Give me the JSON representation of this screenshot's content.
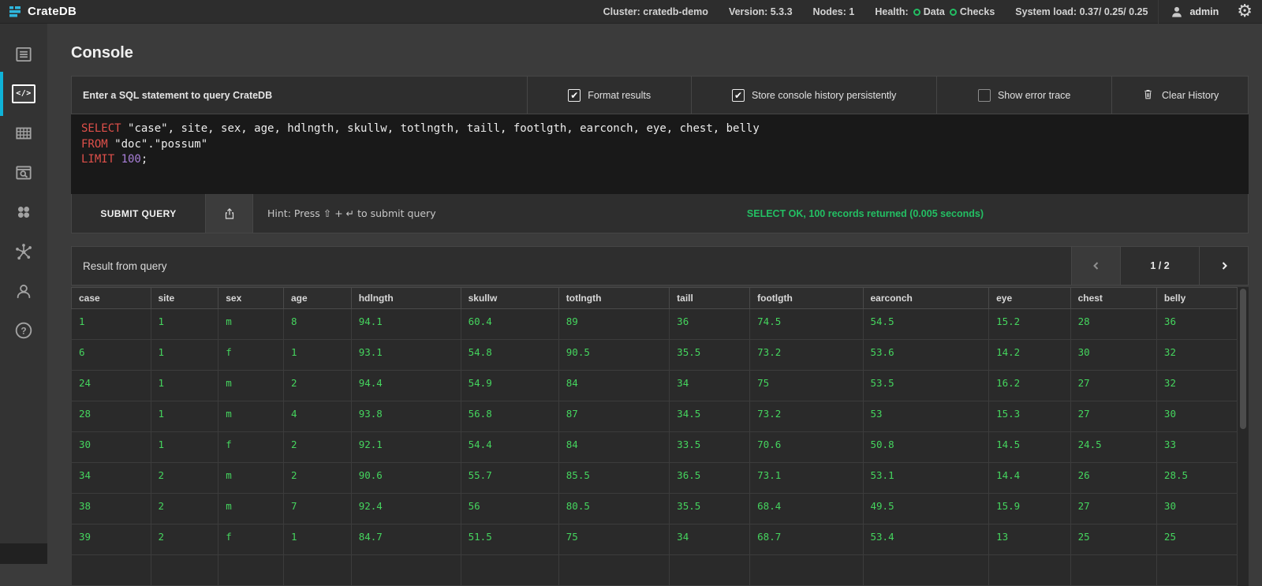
{
  "topbar": {
    "brand": "CrateDB",
    "cluster": "Cluster: cratedb-demo",
    "version": "Version: 5.3.3",
    "nodes": "Nodes: 1",
    "health_label": "Health:",
    "health_items": [
      "Data",
      "Checks"
    ],
    "load": "System load: 0.37/ 0.25/ 0.25",
    "user": "admin"
  },
  "sidebar": {
    "items": [
      "overview",
      "console",
      "tables",
      "shards",
      "privileges",
      "cluster",
      "account",
      "help"
    ],
    "active_item": "console",
    "accent_color": "#0fb3d8"
  },
  "console": {
    "title": "Console",
    "editor_label": "Enter a SQL statement to query CrateDB",
    "options": [
      {
        "label": "Format results",
        "checked": true
      },
      {
        "label": "Store console history persistently",
        "checked": true
      },
      {
        "label": "Show error trace",
        "checked": false
      }
    ],
    "clear_history_label": "Clear History",
    "sql_lines": [
      [
        {
          "t": "kw",
          "v": "SELECT "
        },
        {
          "t": "p",
          "v": "\"case\", site, sex, age, hdlngth, skullw, totlngth, taill, footlgth, earconch, eye, chest, belly"
        }
      ],
      [
        {
          "t": "kw",
          "v": "FROM "
        },
        {
          "t": "p",
          "v": "\"doc\".\"possum\""
        }
      ],
      [
        {
          "t": "kw",
          "v": "LIMIT "
        },
        {
          "t": "num",
          "v": "100"
        },
        {
          "t": "p",
          "v": ";"
        }
      ]
    ],
    "submit_label": "SUBMIT QUERY",
    "hint": "Hint: Press ⇧ + ↵ to submit query",
    "status": "SELECT OK, 100 records returned (0.005 seconds)"
  },
  "results": {
    "title": "Result from query",
    "page_indicator": "1 / 2",
    "columns": [
      "case",
      "site",
      "sex",
      "age",
      "hdlngth",
      "skullw",
      "totlngth",
      "taill",
      "footlgth",
      "earconch",
      "eye",
      "chest",
      "belly"
    ],
    "col_widths_pct": [
      6.8,
      5.8,
      5.6,
      5.8,
      9.4,
      8.4,
      9.5,
      6.9,
      9.7,
      10.8,
      7.0,
      7.4,
      6.9
    ],
    "rows": [
      [
        "1",
        "1",
        "m",
        "8",
        "94.1",
        "60.4",
        "89",
        "36",
        "74.5",
        "54.5",
        "15.2",
        "28",
        "36"
      ],
      [
        "6",
        "1",
        "f",
        "1",
        "93.1",
        "54.8",
        "90.5",
        "35.5",
        "73.2",
        "53.6",
        "14.2",
        "30",
        "32"
      ],
      [
        "24",
        "1",
        "m",
        "2",
        "94.4",
        "54.9",
        "84",
        "34",
        "75",
        "53.5",
        "16.2",
        "27",
        "32"
      ],
      [
        "28",
        "1",
        "m",
        "4",
        "93.8",
        "56.8",
        "87",
        "34.5",
        "73.2",
        "53",
        "15.3",
        "27",
        "30"
      ],
      [
        "30",
        "1",
        "f",
        "2",
        "92.1",
        "54.4",
        "84",
        "33.5",
        "70.6",
        "50.8",
        "14.5",
        "24.5",
        "33"
      ],
      [
        "34",
        "2",
        "m",
        "2",
        "90.6",
        "55.7",
        "85.5",
        "36.5",
        "73.1",
        "53.1",
        "14.4",
        "26",
        "28.5"
      ],
      [
        "38",
        "2",
        "m",
        "7",
        "92.4",
        "56",
        "80.5",
        "35.5",
        "68.4",
        "49.5",
        "15.9",
        "27",
        "30"
      ],
      [
        "39",
        "2",
        "f",
        "1",
        "84.7",
        "51.5",
        "75",
        "34",
        "68.7",
        "53.4",
        "13",
        "25",
        "25"
      ]
    ],
    "partial_row": true
  },
  "colors": {
    "accent_cyan": "#0fb3d8",
    "success_green": "#23bf63",
    "value_green": "#45d55e",
    "keyword_red": "#e0504a",
    "number_purple": "#a87fd8"
  }
}
